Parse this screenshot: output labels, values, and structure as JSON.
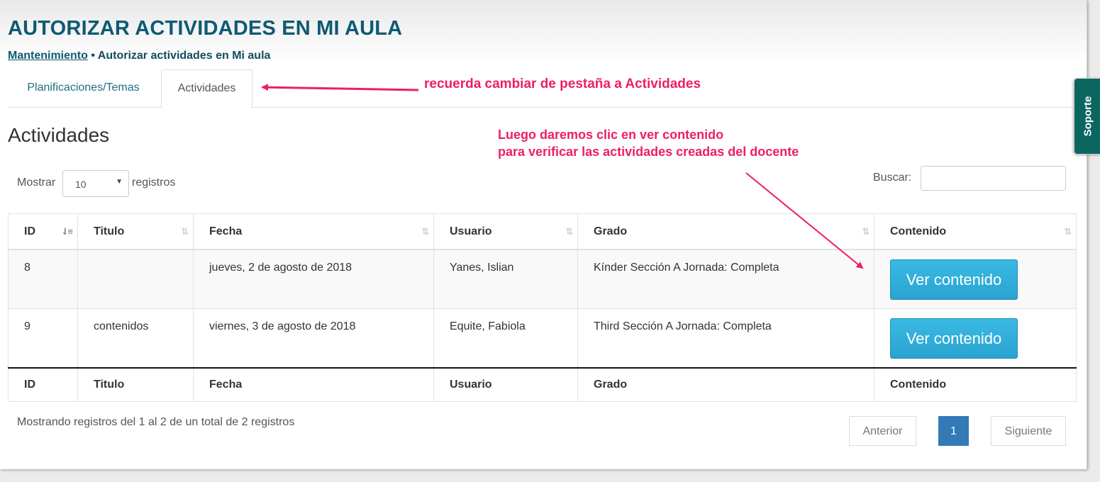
{
  "header": {
    "title": "AUTORIZAR ACTIVIDADES EN MI AULA",
    "breadcrumb_link": "Mantenimiento",
    "breadcrumb_separator": " • ",
    "breadcrumb_current": "Autorizar actividades en Mi aula"
  },
  "tabs": [
    {
      "label": "Planificaciones/Temas",
      "active": false
    },
    {
      "label": "Actividades",
      "active": true
    }
  ],
  "section_title": "Actividades",
  "length": {
    "prefix": "Mostrar",
    "value": "10",
    "suffix": "registros"
  },
  "search": {
    "label": "Buscar:",
    "value": ""
  },
  "table": {
    "columns": [
      "ID",
      "Titulo",
      "Fecha",
      "Usuario",
      "Grado",
      "Contenido"
    ],
    "rows": [
      {
        "id": "8",
        "titulo": "",
        "fecha": "jueves, 2 de agosto de 2018",
        "usuario": "Yanes, Islian",
        "grado": "Kínder Sección A Jornada: Completa",
        "button": "Ver contenido"
      },
      {
        "id": "9",
        "titulo": "contenidos",
        "fecha": "viernes, 3 de agosto de 2018",
        "usuario": "Equite, Fabiola",
        "grado": "Third Sección A Jornada: Completa",
        "button": "Ver contenido"
      }
    ]
  },
  "info": "Mostrando registros del 1 al 2 de un total de 2 registros",
  "pagination": {
    "prev": "Anterior",
    "current": "1",
    "next": "Siguiente"
  },
  "support_tab": "Soporte",
  "annotations": {
    "tab_hint": "recuerda cambiar de pestaña a Actividades",
    "button_hint_line1": "Luego daremos clic en ver contenido",
    "button_hint_line2": "para verificar las actividades creadas del docente"
  },
  "colors": {
    "title": "#0e5a73",
    "annotation": "#ee1e62",
    "button": "#33afdb",
    "pager_active": "#337ab7",
    "support_tab": "#0c6660"
  }
}
